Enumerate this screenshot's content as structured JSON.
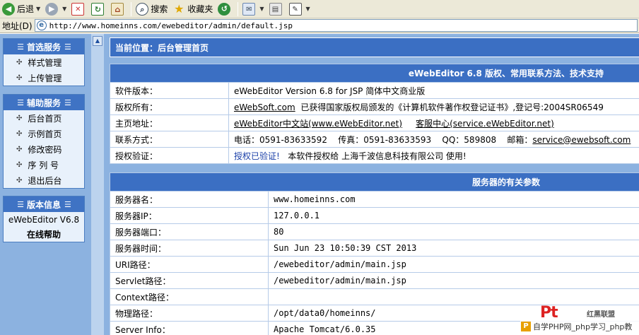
{
  "toolbar": {
    "back_label": "后退",
    "search_label": "搜索",
    "favorites_label": "收藏夹"
  },
  "address": {
    "label": "地址(D)",
    "url": "http://www.homeinns.com/ewebeditor/admin/default.jsp"
  },
  "sidebar": {
    "panel1": {
      "title": "首选服务",
      "items": [
        "样式管理",
        "上传管理"
      ]
    },
    "panel2": {
      "title": "辅助服务",
      "items": [
        "后台首页",
        "示例首页",
        "修改密码",
        "序 列 号",
        "退出后台"
      ]
    },
    "panel3": {
      "title": "版本信息",
      "version": "eWebEditor V6.8",
      "help": "在线帮助"
    }
  },
  "main": {
    "location": "当前位置：后台管理首页",
    "info_title": "eWebEditor 6.8 版权、常用联系方法、技术支持",
    "info": {
      "version_label": "软件版本：",
      "version_value": "eWebEditor Version 6.8 for JSP 简体中文商业版",
      "copyright_label": "版权所有：",
      "copyright_link": "eWebSoft.com",
      "copyright_text": "已获得国家版权局颁发的《计算机软件著作权登记证书》,登记号:2004SR06549",
      "homepage_label": "主页地址：",
      "homepage_link1": "eWebEditor中文站(www.eWebEditor.net)",
      "homepage_link2": "客服中心(service.eWebEditor.net)",
      "contact_label": "联系方式：",
      "contact_text": "电话：0591-83633592    传真：0591-83633593    QQ：589808    邮箱：",
      "contact_email": "service@ewebsoft.com",
      "license_label": "授权验证：",
      "license_status": "授权已验证!",
      "license_text": "本软件授权给 上海千波信息科技有限公司 使用!"
    },
    "server_title": "服务器的有关参数",
    "server_rows": [
      {
        "label": "服务器名：",
        "value": "www.homeinns.com"
      },
      {
        "label": "服务器IP：",
        "value": "127.0.0.1"
      },
      {
        "label": "服务器端口：",
        "value": "80"
      },
      {
        "label": "服务器时间：",
        "value": "Sun Jun 23 10:50:39 CST 2013"
      },
      {
        "label": "URI路径：",
        "value": "/ewebeditor/admin/main.jsp"
      },
      {
        "label": "Servlet路径：",
        "value": "/ewebeditor/admin/main.jsp"
      },
      {
        "label": "Context路径：",
        "value": ""
      },
      {
        "label": "物理路径：",
        "value": "/opt/data0/homeinns/"
      },
      {
        "label": "Server Info：",
        "value": "Apache Tomcat/6.0.35"
      }
    ]
  },
  "watermark": {
    "logo": "Pt",
    "tag": "红黑联盟",
    "text": "自学PHP网_php学习_php教"
  },
  "colors": {
    "header_blue": "#3b6fc3",
    "frame_blue": "#8cb2e0",
    "panel_bg": "#e8f1fb"
  }
}
